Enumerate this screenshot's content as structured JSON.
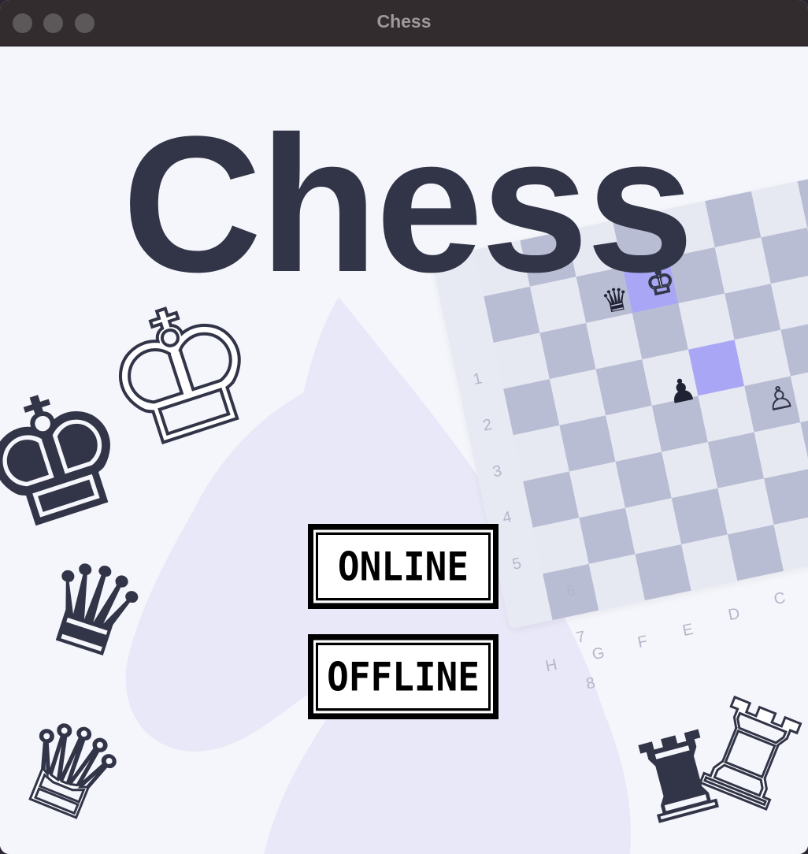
{
  "window": {
    "title": "Chess",
    "traffic_light_color": "#5c585a"
  },
  "app": {
    "title": "Chess",
    "title_color": "#323548",
    "background": "#f5f6fb"
  },
  "menu": {
    "online_label": "ONLINE",
    "offline_label": "OFFLINE"
  },
  "board": {
    "ranks": [
      "1",
      "2",
      "3",
      "4",
      "5",
      "6",
      "7",
      "8"
    ],
    "files": [
      "H",
      "G",
      "F",
      "E",
      "D",
      "C"
    ],
    "light_color": "#e6e8f2",
    "dark_color": "#b9bdd3",
    "highlight_color": "#a9a7f5",
    "pieces": [
      {
        "name": "black-queen-icon",
        "glyph": "♛"
      },
      {
        "name": "black-king-icon",
        "glyph": "♚"
      },
      {
        "name": "black-pawn-icon",
        "glyph": "♟"
      },
      {
        "name": "white-pawn-icon",
        "glyph": "♙"
      }
    ]
  },
  "decorations": [
    "knight-silhouette-icon",
    "black-king-icon",
    "white-king-icon",
    "black-queen-icon",
    "white-queen-icon",
    "black-rook-icon",
    "white-rook-icon"
  ]
}
